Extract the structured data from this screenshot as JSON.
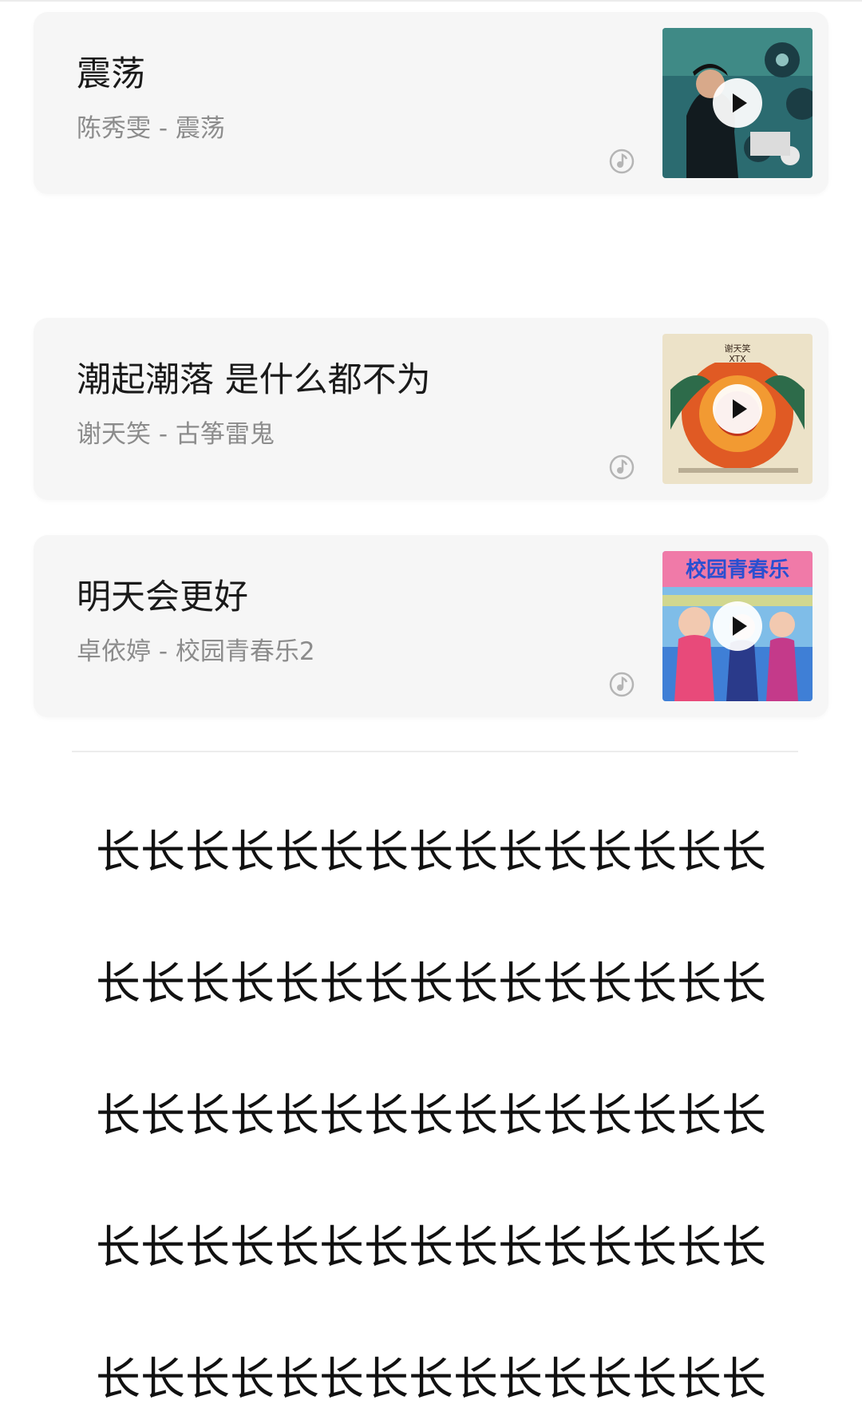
{
  "songs": [
    {
      "title": "震荡",
      "artist": "陈秀雯",
      "album": "震荡",
      "subtitle": "陈秀雯 - 震荡",
      "cover_colors": [
        "#1f4f5a",
        "#3b7a7a",
        "#0d1a1e"
      ],
      "source_icon": "qq-music-icon",
      "play_icon": "play-icon"
    },
    {
      "title": "潮起潮落 是什么都不为",
      "artist": "谢天笑",
      "album": "古筝雷鬼",
      "subtitle": "谢天笑 - 古筝雷鬼",
      "cover_text": "谢天笑 XTX",
      "cover_colors": [
        "#e8d9b8",
        "#d9542a",
        "#f2a23a"
      ],
      "source_icon": "qq-music-icon",
      "play_icon": "play-icon"
    },
    {
      "title": "明天会更好",
      "artist": "卓依婷",
      "album": "校园青春乐2",
      "subtitle": "卓依婷 - 校园青春乐2",
      "cover_text": "校园青春乐",
      "cover_colors": [
        "#e94a8a",
        "#6fb2e8",
        "#f3e26a"
      ],
      "source_icon": "qq-music-icon",
      "play_icon": "play-icon"
    }
  ],
  "long_text_rows": [
    "长长长长长长长长长长长长长长长",
    "长长长长长长长长长长长长长长长",
    "长长长长长长长长长长长长长长长",
    "长长长长长长长长长长长长长长长",
    "长长长长长长长长长长长长长长长"
  ]
}
